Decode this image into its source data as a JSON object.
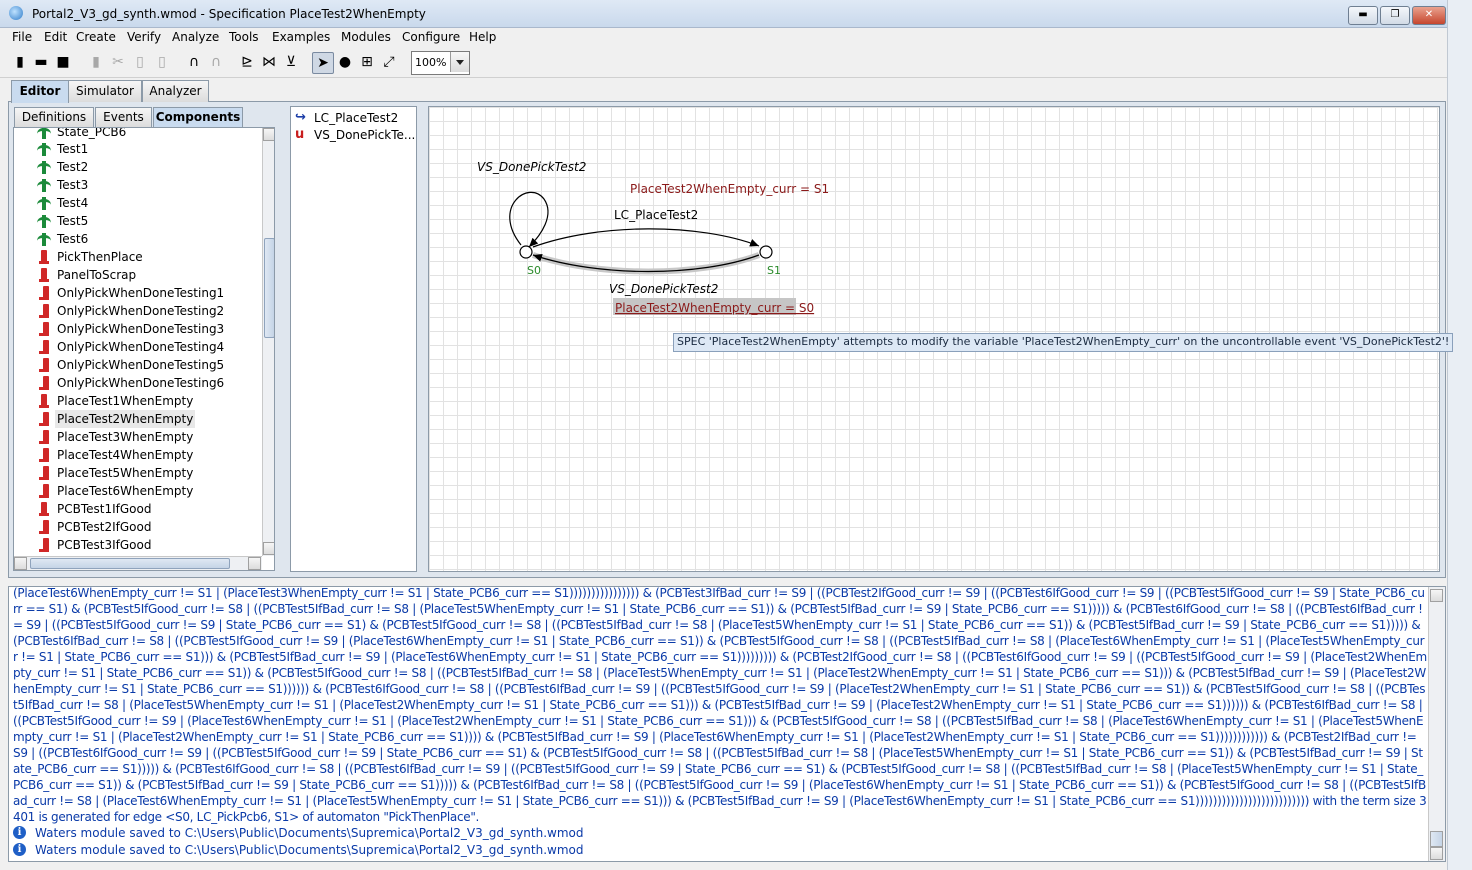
{
  "window": {
    "title": "Portal2_V3_gd_synth.wmod - Specification PlaceTest2WhenEmpty",
    "minimize": "▬",
    "maximize": "❐",
    "close": "✕"
  },
  "menu": [
    "File",
    "Edit",
    "Create",
    "Verify",
    "Analyze",
    "Tools",
    "Examples",
    "Modules",
    "Configure",
    "Help"
  ],
  "toolbar": {
    "zoom": "100%",
    "icons": [
      "new-icon",
      "open-icon",
      "save-icon",
      "delete-icon",
      "cut-icon",
      "copy-icon",
      "undo-icon",
      "redo-icon",
      "layout-icon",
      "layout-spring-icon",
      "layout-tree-icon",
      "select-tool-icon",
      "node-tool-icon",
      "group-node-tool-icon",
      "edge-tool-icon"
    ]
  },
  "main_tabs": [
    "Editor",
    "Simulator",
    "Analyzer"
  ],
  "sub_tabs": [
    "Definitions",
    "Events",
    "Components"
  ],
  "tree": {
    "partial_top": "State_PCB6",
    "items": [
      {
        "label": "Test1",
        "kind": "plant"
      },
      {
        "label": "Test2",
        "kind": "plant"
      },
      {
        "label": "Test3",
        "kind": "plant"
      },
      {
        "label": "Test4",
        "kind": "plant"
      },
      {
        "label": "Test5",
        "kind": "plant"
      },
      {
        "label": "Test6",
        "kind": "plant"
      },
      {
        "label": "PickThenPlace",
        "kind": "spec"
      },
      {
        "label": "PanelToScrap",
        "kind": "spec"
      },
      {
        "label": "OnlyPickWhenDoneTesting1",
        "kind": "spec-bang"
      },
      {
        "label": "OnlyPickWhenDoneTesting2",
        "kind": "spec-bang"
      },
      {
        "label": "OnlyPickWhenDoneTesting3",
        "kind": "spec-bang"
      },
      {
        "label": "OnlyPickWhenDoneTesting4",
        "kind": "spec-bang"
      },
      {
        "label": "OnlyPickWhenDoneTesting5",
        "kind": "spec-bang"
      },
      {
        "label": "OnlyPickWhenDoneTesting6",
        "kind": "spec-bang"
      },
      {
        "label": "PlaceTest1WhenEmpty",
        "kind": "spec"
      },
      {
        "label": "PlaceTest2WhenEmpty",
        "kind": "spec-bang",
        "selected": true
      },
      {
        "label": "PlaceTest3WhenEmpty",
        "kind": "spec-bang"
      },
      {
        "label": "PlaceTest4WhenEmpty",
        "kind": "spec-bang"
      },
      {
        "label": "PlaceTest5WhenEmpty",
        "kind": "spec-bang"
      },
      {
        "label": "PlaceTest6WhenEmpty",
        "kind": "spec-bang"
      },
      {
        "label": "PCBTest1IfGood",
        "kind": "spec"
      },
      {
        "label": "PCBTest2IfGood",
        "kind": "spec-bang"
      },
      {
        "label": "PCBTest3IfGood",
        "kind": "spec-bang"
      }
    ]
  },
  "events": [
    {
      "label": "LC_PlaceTest2",
      "kind": "controllable"
    },
    {
      "label": "VS_DonePickTe...",
      "kind": "uncontrollable"
    }
  ],
  "graph": {
    "states": [
      "S0",
      "S1"
    ],
    "selfloop_label": "VS_DonePickTest2",
    "guard_top": "PlaceTest2WhenEmpty_curr = S1",
    "edge_top_label": "LC_PlaceTest2",
    "edge_bottom_label": "VS_DonePickTest2",
    "guard_bottom": "PlaceTest2WhenEmpty_curr = S0",
    "tooltip": "SPEC 'PlaceTest2WhenEmpty' attempts to modify the variable 'PlaceTest2WhenEmpty_curr' on the uncontrollable event 'VS_DonePickTest2'!",
    "colors": {
      "state_label": "#2a8a2a",
      "guard": "#8b1a1a"
    }
  },
  "console": {
    "expression": "(PlaceTest6WhenEmpty_curr != S1 | (PlaceTest3WhenEmpty_curr != S1 | State_PCB6_curr == S1)))))))))))))))) & (PCBTest3IfBad_curr != S9 | ((PCBTest2IfGood_curr != S9 | ((PCBTest6IfGood_curr != S9 | ((PCBTest5IfGood_curr != S9 | State_PCB6_curr == S1) & (PCBTest5IfGood_curr != S8 | ((PCBTest5IfBad_curr != S8 | (PlaceTest5WhenEmpty_curr != S1 | State_PCB6_curr == S1)) & (PCBTest5IfBad_curr != S9 | State_PCB6_curr == S1))))) & (PCBTest6IfGood_curr != S8 | ((PCBTest6IfBad_curr != S9 | ((PCBTest5IfGood_curr != S9 | State_PCB6_curr == S1) & (PCBTest5IfGood_curr != S8 | ((PCBTest5IfBad_curr != S8 | (PlaceTest5WhenEmpty_curr != S1 | State_PCB6_curr == S1)) & (PCBTest5IfBad_curr != S9 | State_PCB6_curr == S1))))) & (PCBTest6IfBad_curr != S8 | ((PCBTest5IfGood_curr != S9 | (PlaceTest6WhenEmpty_curr != S1 | State_PCB6_curr == S1)) & (PCBTest5IfGood_curr != S8 | ((PCBTest5IfBad_curr != S8 | (PlaceTest6WhenEmpty_curr != S1 | (PlaceTest5WhenEmpty_curr != S1 | State_PCB6_curr == S1))) & (PCBTest5IfBad_curr != S9 | (PlaceTest6WhenEmpty_curr != S1 | State_PCB6_curr == S1))))))))) & (PCBTest2IfGood_curr != S8 | ((PCBTest6IfGood_curr != S9 | ((PCBTest5IfGood_curr != S9 | (PlaceTest2WhenEmpty_curr != S1 | State_PCB6_curr == S1)) & (PCBTest5IfGood_curr != S8 | ((PCBTest5IfBad_curr != S8 | (PlaceTest5WhenEmpty_curr != S1 | (PlaceTest2WhenEmpty_curr != S1 | State_PCB6_curr == S1))) & (PCBTest5IfBad_curr != S9 | (PlaceTest2WhenEmpty_curr != S1 | State_PCB6_curr == S1)))))) & (PCBTest6IfGood_curr != S8 | ((PCBTest6IfBad_curr != S9 | ((PCBTest5IfGood_curr != S9 | (PlaceTest2WhenEmpty_curr != S1 | State_PCB6_curr == S1)) & (PCBTest5IfGood_curr != S8 | ((PCBTest5IfBad_curr != S8 | (PlaceTest5WhenEmpty_curr != S1 | (PlaceTest2WhenEmpty_curr != S1 | State_PCB6_curr == S1))) & (PCBTest5IfBad_curr != S9 | (PlaceTest2WhenEmpty_curr != S1 | State_PCB6_curr == S1)))))) & (PCBTest6IfBad_curr != S8 | ((PCBTest5IfGood_curr != S9 | (PlaceTest6WhenEmpty_curr != S1 | (PlaceTest2WhenEmpty_curr != S1 | State_PCB6_curr == S1))) & (PCBTest5IfGood_curr != S8 | ((PCBTest5IfBad_curr != S8 | (PlaceTest6WhenEmpty_curr != S1 | (PlaceTest5WhenEmpty_curr != S1 | (PlaceTest2WhenEmpty_curr != S1 | State_PCB6_curr == S1)))) & (PCBTest5IfBad_curr != S9 | (PlaceTest6WhenEmpty_curr != S1 | (PlaceTest2WhenEmpty_curr != S1 | State_PCB6_curr == S1)))))))))))) & (PCBTest2IfBad_curr != S9 | ((PCBTest6IfGood_curr != S9 | ((PCBTest5IfGood_curr != S9 | State_PCB6_curr == S1) & (PCBTest5IfGood_curr != S8 | ((PCBTest5IfBad_curr != S8 | (PlaceTest5WhenEmpty_curr != S1 | State_PCB6_curr == S1)) & (PCBTest5IfBad_curr != S9 | State_PCB6_curr == S1))))) & (PCBTest6IfGood_curr != S8 | ((PCBTest6IfBad_curr != S9 | ((PCBTest5IfGood_curr != S9 | State_PCB6_curr == S1) & (PCBTest5IfGood_curr != S8 | ((PCBTest5IfBad_curr != S8 | (PlaceTest5WhenEmpty_curr != S1 | State_PCB6_curr == S1)) & (PCBTest5IfBad_curr != S9 | State_PCB6_curr == S1))))) & (PCBTest6IfBad_curr != S8 | ((PCBTest5IfGood_curr != S9 | (PlaceTest6WhenEmpty_curr != S1 | State_PCB6_curr == S1)) & (PCBTest5IfGood_curr != S8 | ((PCBTest5IfBad_curr != S8 | (PlaceTest6WhenEmpty_curr != S1 | (PlaceTest5WhenEmpty_curr != S1 | State_PCB6_curr == S1))) & (PCBTest5IfBad_curr != S9 | (PlaceTest6WhenEmpty_curr != S1 | State_PCB6_curr == S1)))))))))))))))))))))))))) with the term size 3401 is generated for edge <S0, LC_PickPcb6, S1> of automaton \"PickThenPlace\".",
    "info_messages": [
      "Waters module saved to C:\\Users\\Public\\Documents\\Supremica\\Portal2_V3_gd_synth.wmod",
      "Waters module saved to C:\\Users\\Public\\Documents\\Supremica\\Portal2_V3_gd_synth.wmod"
    ]
  }
}
